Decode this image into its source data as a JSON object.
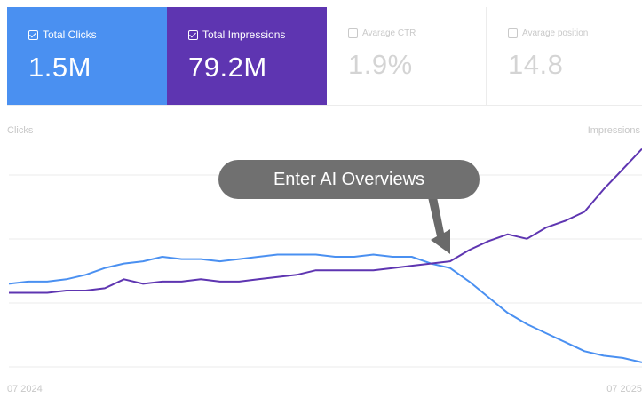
{
  "metrics": [
    {
      "label": "Total Clicks",
      "value": "1.5M",
      "checked": true,
      "color": "#4a90f1"
    },
    {
      "label": "Total Impressions",
      "value": "79.2M",
      "checked": true,
      "color": "#5e35b1"
    },
    {
      "label": "Avarage CTR",
      "value": "1.9%",
      "checked": false
    },
    {
      "label": "Avarage position",
      "value": "14.8",
      "checked": false
    }
  ],
  "chart": {
    "left_axis_title": "Clicks",
    "right_axis_title": "Impressions",
    "start_date": "07 2024",
    "end_date": "07 2025",
    "annotation": "Enter AI Overviews"
  },
  "chart_data": {
    "type": "line",
    "x_range": [
      "07 2024",
      "07 2025"
    ],
    "grid": true,
    "series": [
      {
        "name": "Total Clicks",
        "color": "#4a90f1",
        "axis": "left",
        "values": [
          0.37,
          0.38,
          0.38,
          0.39,
          0.41,
          0.44,
          0.46,
          0.47,
          0.49,
          0.48,
          0.48,
          0.47,
          0.48,
          0.49,
          0.5,
          0.5,
          0.5,
          0.49,
          0.49,
          0.5,
          0.49,
          0.49,
          0.46,
          0.44,
          0.38,
          0.31,
          0.24,
          0.19,
          0.15,
          0.11,
          0.07,
          0.05,
          0.04,
          0.02
        ]
      },
      {
        "name": "Total Impressions",
        "color": "#5e35b1",
        "axis": "right",
        "values": [
          0.33,
          0.33,
          0.33,
          0.34,
          0.34,
          0.35,
          0.39,
          0.37,
          0.38,
          0.38,
          0.39,
          0.38,
          0.38,
          0.39,
          0.4,
          0.41,
          0.43,
          0.43,
          0.43,
          0.43,
          0.44,
          0.45,
          0.46,
          0.47,
          0.52,
          0.56,
          0.59,
          0.57,
          0.62,
          0.65,
          0.69,
          0.79,
          0.88,
          0.97
        ]
      }
    ]
  }
}
